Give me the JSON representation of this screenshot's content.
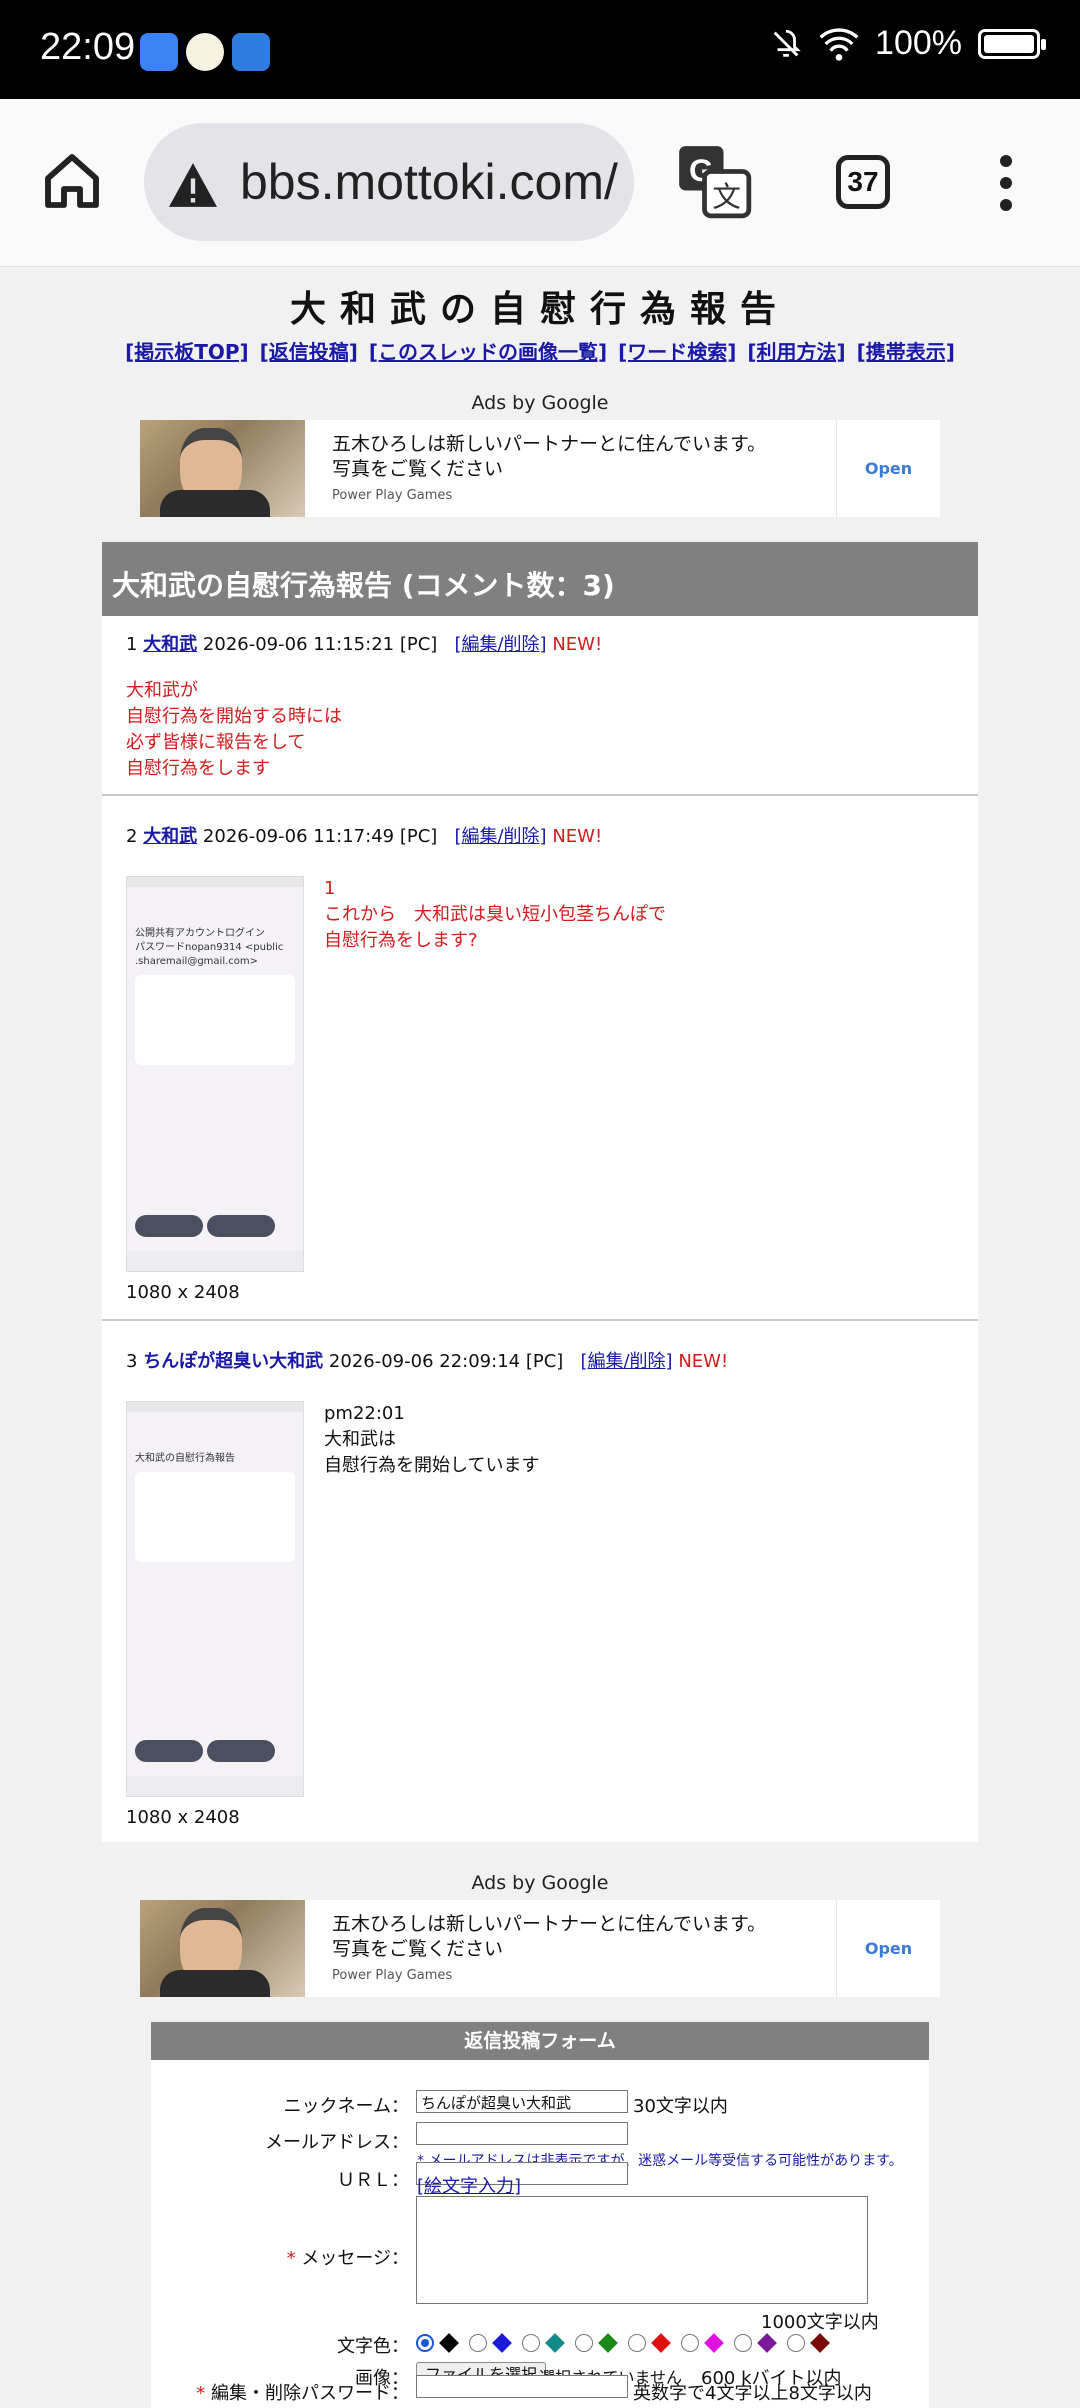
{
  "status_bar": {
    "time": "22:09",
    "battery": "100%",
    "battery_level": 1.0
  },
  "browser": {
    "url": "bbs.mottoki.com/",
    "tab_count": "37"
  },
  "page": {
    "title": "大和武の自慰行為報告",
    "links": [
      "[掲示板TOP]",
      "[返信投稿]",
      "[このスレッドの画像一覧]",
      "[ワード検索]",
      "[利用方法]",
      "[携帯表示]"
    ]
  },
  "ads": {
    "label": "Ads by Google",
    "text": "五木ひろしは新しいパートナーとに住んでいます。写真をご覧ください",
    "source": "Power Play Games",
    "open": "Open"
  },
  "thread": {
    "header": "大和武の自慰行為報告 (コメント数：3)",
    "posts": [
      {
        "num": "1",
        "name": "大和武",
        "datetime": "2026-09-06 11:15:21 [PC]",
        "edit": "[編集/削除]",
        "new": "NEW!",
        "lines": [
          "大和武が",
          "自慰行為を開始する時には",
          "必ず皆様に報告をして",
          "自慰行為をします"
        ]
      },
      {
        "num": "2",
        "name": "大和武",
        "datetime": "2026-09-06 11:17:49 [PC]",
        "edit": "[編集/削除]",
        "new": "NEW!",
        "lines": [
          "1",
          "これから　大和武は臭い短小包茎ちんぽで",
          "自慰行為をします?"
        ],
        "thumb_lines": [
          "公開共有アカウントログイン",
          "パスワードnopan9314 <public",
          ".sharemail@gmail.com>"
        ],
        "image_size": "1080 x 2408"
      },
      {
        "num": "3",
        "name": "ちんぽが超臭い大和武",
        "datetime": "2026-09-06 22:09:14 [PC]",
        "edit": "[編集/削除]",
        "new": "NEW!",
        "lines": [
          "pm22:01",
          "大和武は",
          "自慰行為を開始しています"
        ],
        "thumb_lines": [
          "大和武の自慰行為報告"
        ],
        "image_size": "1080 x 2408"
      }
    ]
  },
  "form": {
    "header": "返信投稿フォーム",
    "nickname_label": "ニックネーム：",
    "nickname_value": "ちんぽが超臭い大和武",
    "nickname_note": "30文字以内",
    "email_label": "メールアドレス：",
    "email_note": "* メールアドレスは非表示ですが、迷惑メール等受信する可能性があります。",
    "url_label": "ＵＲＬ：",
    "emoji_link": "[絵文字入力]",
    "message_label": "メッセージ：",
    "message_note": "1000文字以内",
    "color_label": "文字色：",
    "colors": [
      "#000000",
      "#1a1ad6",
      "#138a8a",
      "#1a8a1a",
      "#e01010",
      "#e010e0",
      "#7a1a9a",
      "#7a0a0a"
    ],
    "image_label": "画像：",
    "file_button": "ファイルを選択",
    "file_status": "選択されていません",
    "file_note": "600 kバイト以内",
    "password_label": "編集・削除パスワード：",
    "password_note": "英数字で4文字以上8文字以内"
  }
}
